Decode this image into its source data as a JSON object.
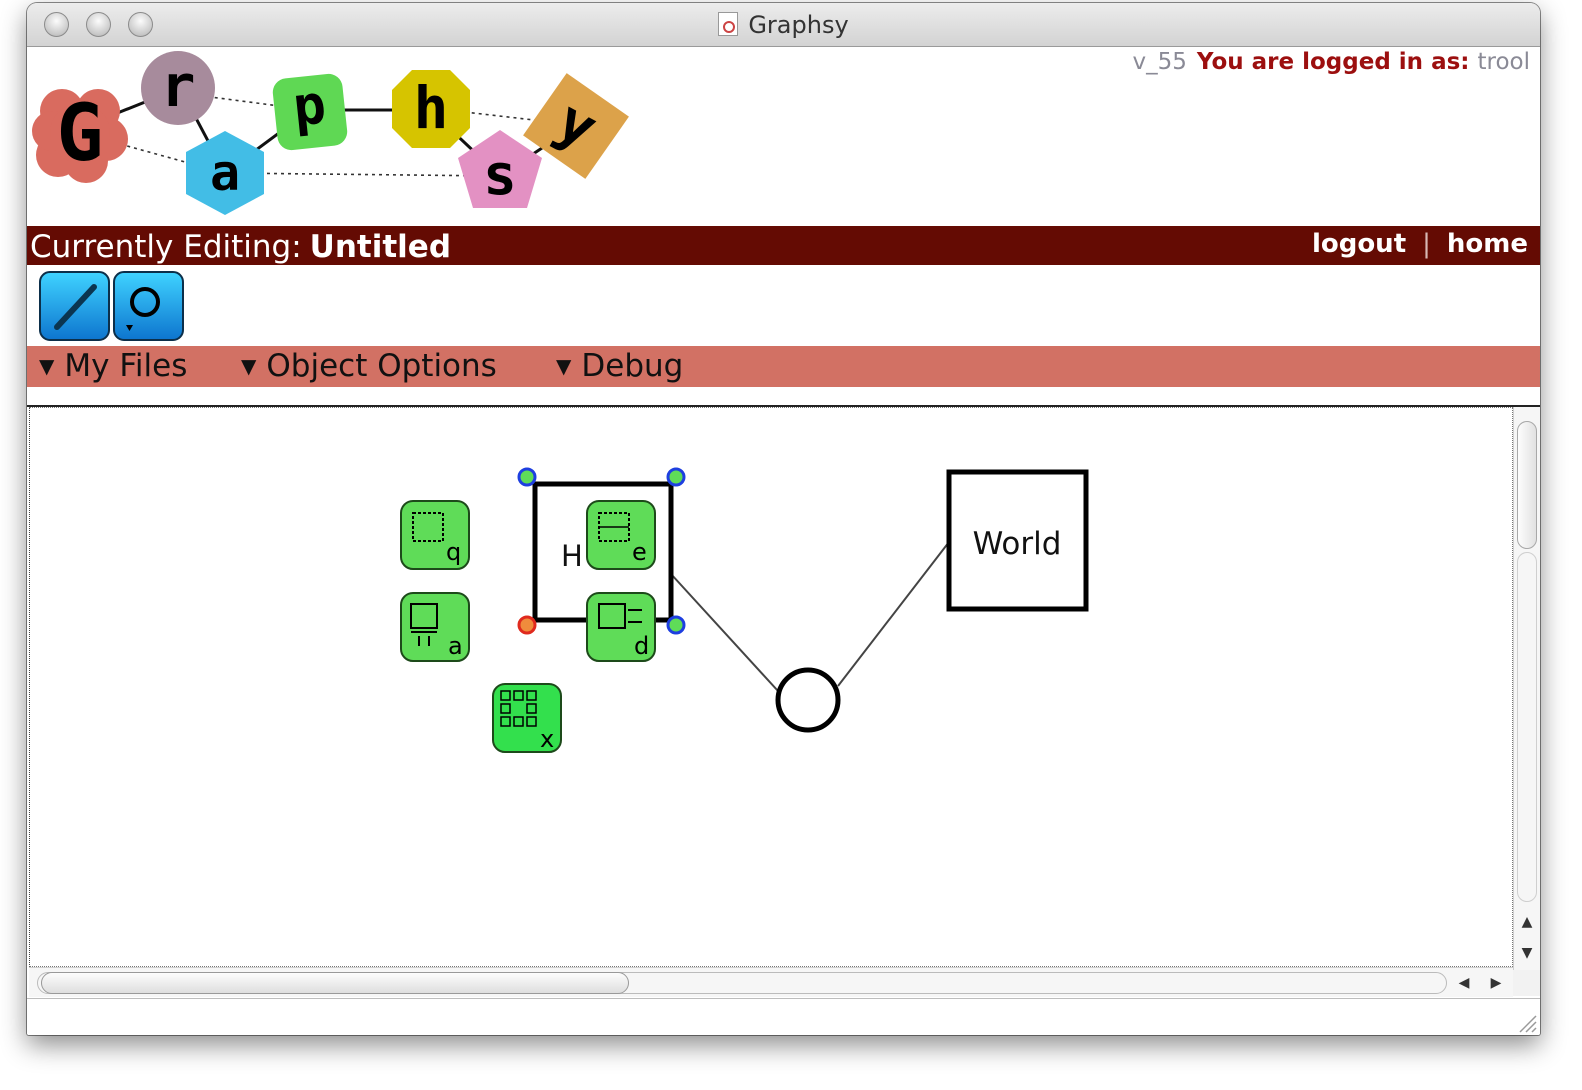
{
  "window": {
    "title": "Graphsy"
  },
  "logo": {
    "letters": [
      "G",
      "r",
      "a",
      "p",
      "h",
      "s",
      "y"
    ]
  },
  "header": {
    "version": "v_55",
    "logged_in_label": "You are logged in as:",
    "username": "trool"
  },
  "edit_bar": {
    "label": "Currently Editing:",
    "document": "Untitled",
    "logout": "logout",
    "separator": "|",
    "home": "home"
  },
  "toolbar": {
    "tools": [
      "line-tool-icon",
      "circle-tool-icon"
    ]
  },
  "menus": [
    {
      "label": "My Files"
    },
    {
      "label": "Object Options"
    },
    {
      "label": "Debug"
    }
  ],
  "canvas": {
    "nodes": {
      "hello": {
        "label": "H"
      },
      "world": {
        "label": "World"
      }
    },
    "palette": [
      {
        "letter": "q",
        "icon": "resize-box-icon"
      },
      {
        "letter": "e",
        "icon": "edit-box-icon"
      },
      {
        "letter": "a",
        "icon": "add-box-icon"
      },
      {
        "letter": "d",
        "icon": "delete-box-icon"
      },
      {
        "letter": "x",
        "icon": "grid-icon"
      }
    ]
  },
  "colors": {
    "edit_bar": "#640b03",
    "menu_bar": "#d27164",
    "logged_in_label": "#9c0f0f",
    "palette_green": "#5fdc58",
    "tool_blue": "#1ea6ee"
  }
}
